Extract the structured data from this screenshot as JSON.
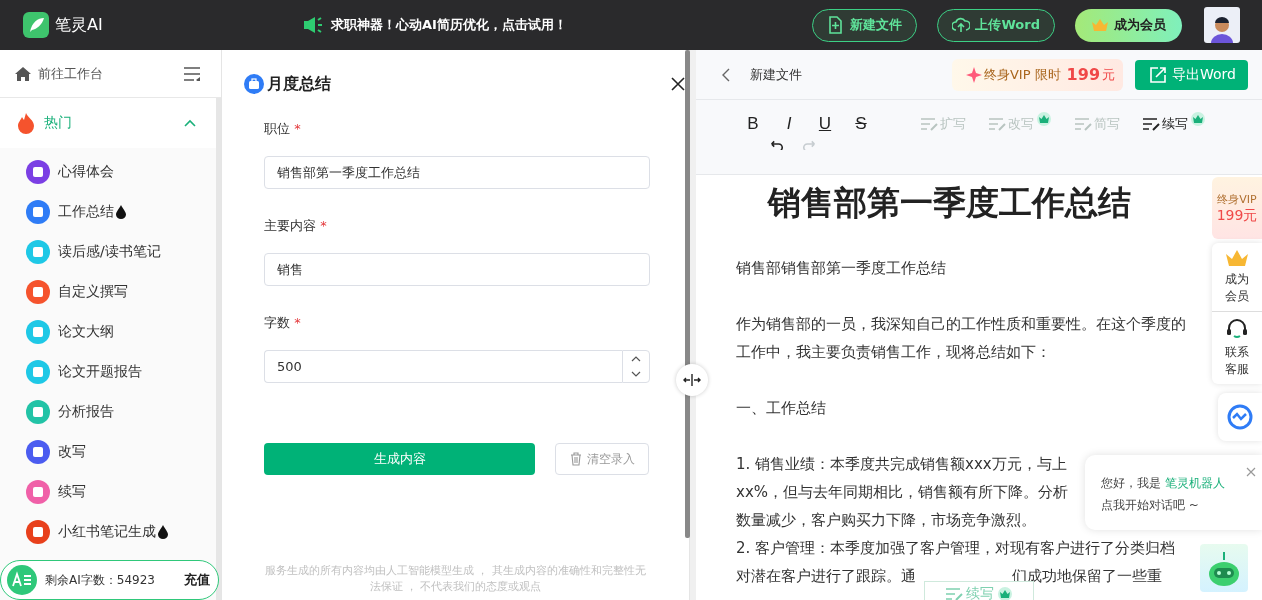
{
  "header": {
    "brand": "笔灵AI",
    "announcement": "求职神器！心动AI简历优化，点击试用！",
    "buttons": [
      {
        "label": "新建文件",
        "kind": "new"
      },
      {
        "label": "上传Word",
        "kind": "upload"
      },
      {
        "label": "成为会员",
        "kind": "vip"
      }
    ]
  },
  "sidebar": {
    "workspace_link": "前往工作台",
    "groups": [
      {
        "label": "热门",
        "expanded": true,
        "items": [
          {
            "label": "心得体会",
            "color": "#7b3fe4",
            "hot": false
          },
          {
            "label": "工作总结",
            "color": "#2f7cf6",
            "hot": true
          },
          {
            "label": "读后感/读书笔记",
            "color": "#1ec8e6",
            "hot": false
          },
          {
            "label": "自定义撰写",
            "color": "#f5532d",
            "hot": false
          },
          {
            "label": "论文大纲",
            "color": "#1ec8e6",
            "hot": false
          },
          {
            "label": "论文开题报告",
            "color": "#1ec8e6",
            "hot": false
          },
          {
            "label": "分析报告",
            "color": "#22c3a6",
            "hot": false
          },
          {
            "label": "改写",
            "color": "#4b5cf0",
            "hot": false
          },
          {
            "label": "续写",
            "color": "#f060a8",
            "hot": false
          },
          {
            "label": "小红书笔记生成",
            "color": "#e8401c",
            "hot": true
          }
        ]
      }
    ],
    "balance": {
      "label": "剩余AI字数：54923",
      "action": "充值"
    }
  },
  "form": {
    "title": "月度总结",
    "fields": [
      {
        "label": "职位",
        "required": true,
        "required_mark": "*",
        "value": "销售部第一季度工作总结",
        "kind": "text"
      },
      {
        "label": "主要内容",
        "required": true,
        "required_mark": "*",
        "value": "销售",
        "kind": "text"
      },
      {
        "label": "字数",
        "required": true,
        "required_mark": "*",
        "value": "500",
        "kind": "number"
      }
    ],
    "generate_button": "生成内容",
    "clear_button": "清空录入",
    "disclaimer": "服务生成的所有内容均由人工智能模型生成 ， 其生成内容的准确性和完整性无法保证 ， 不代表我们的态度或观点"
  },
  "editor": {
    "file_name": "新建文件",
    "promo": {
      "label": "终身VIP 限时",
      "price": "199",
      "unit": "元"
    },
    "export_button": "导出Word",
    "toolbar": [
      {
        "label": "B",
        "kind": "bold",
        "disabled": false
      },
      {
        "label": "I",
        "kind": "italic",
        "disabled": false
      },
      {
        "label": "U",
        "kind": "underline",
        "disabled": false
      },
      {
        "label": "S",
        "kind": "strike",
        "disabled": false
      },
      {
        "label": "扩写",
        "kind": "expand",
        "disabled": true,
        "premium": false
      },
      {
        "label": "改写",
        "kind": "rewrite",
        "disabled": true,
        "premium": true
      },
      {
        "label": "简写",
        "kind": "shorten",
        "disabled": true,
        "premium": false
      },
      {
        "label": "续写",
        "kind": "continue",
        "disabled": false,
        "premium": true
      }
    ],
    "history": [
      {
        "kind": "undo",
        "disabled": false
      },
      {
        "kind": "redo",
        "disabled": true
      }
    ],
    "document": {
      "title": "销售部第一季度工作总结",
      "paragraphs": [
        {
          "lines": [
            {
              "text": "销售部销售部第一季度工作总结"
            }
          ]
        },
        {
          "lines": [
            {
              "text": "作为销售部的一员，我深知自己的工作性质和重要性。在这个季度的"
            },
            {
              "text": "工作中，我主要负责销售工作，现将总结如下："
            }
          ]
        },
        {
          "lines": [
            {
              "text": "一、工作总结"
            }
          ]
        },
        {
          "lines": [
            {
              "text": "1. 销售业绩：本季度共完成销售额xxx万元，与上"
            },
            {
              "text": "xx%，但与去年同期相比，销售额有所下降。分析"
            },
            {
              "text": "数量减少，客户购买力下降，市场竞争激烈。"
            },
            {
              "text": "2. 客户管理：本季度加强了客户管理，对现有客户进行了分类归档"
            },
            {
              "text": "对潜在客户进行了跟踪。通",
              "tail": "们成功地保留了一些重"
            }
          ]
        }
      ]
    },
    "floating_continue": "续写"
  },
  "side_panel": {
    "vip": {
      "label": "终身VIP",
      "price": "199元"
    },
    "member": "成为会员",
    "service": "联系客服"
  },
  "chat_bubble": {
    "greeting": "您好，我是",
    "bot_name": "笔灵机器人",
    "prompt": "点我开始对话吧 ~"
  }
}
